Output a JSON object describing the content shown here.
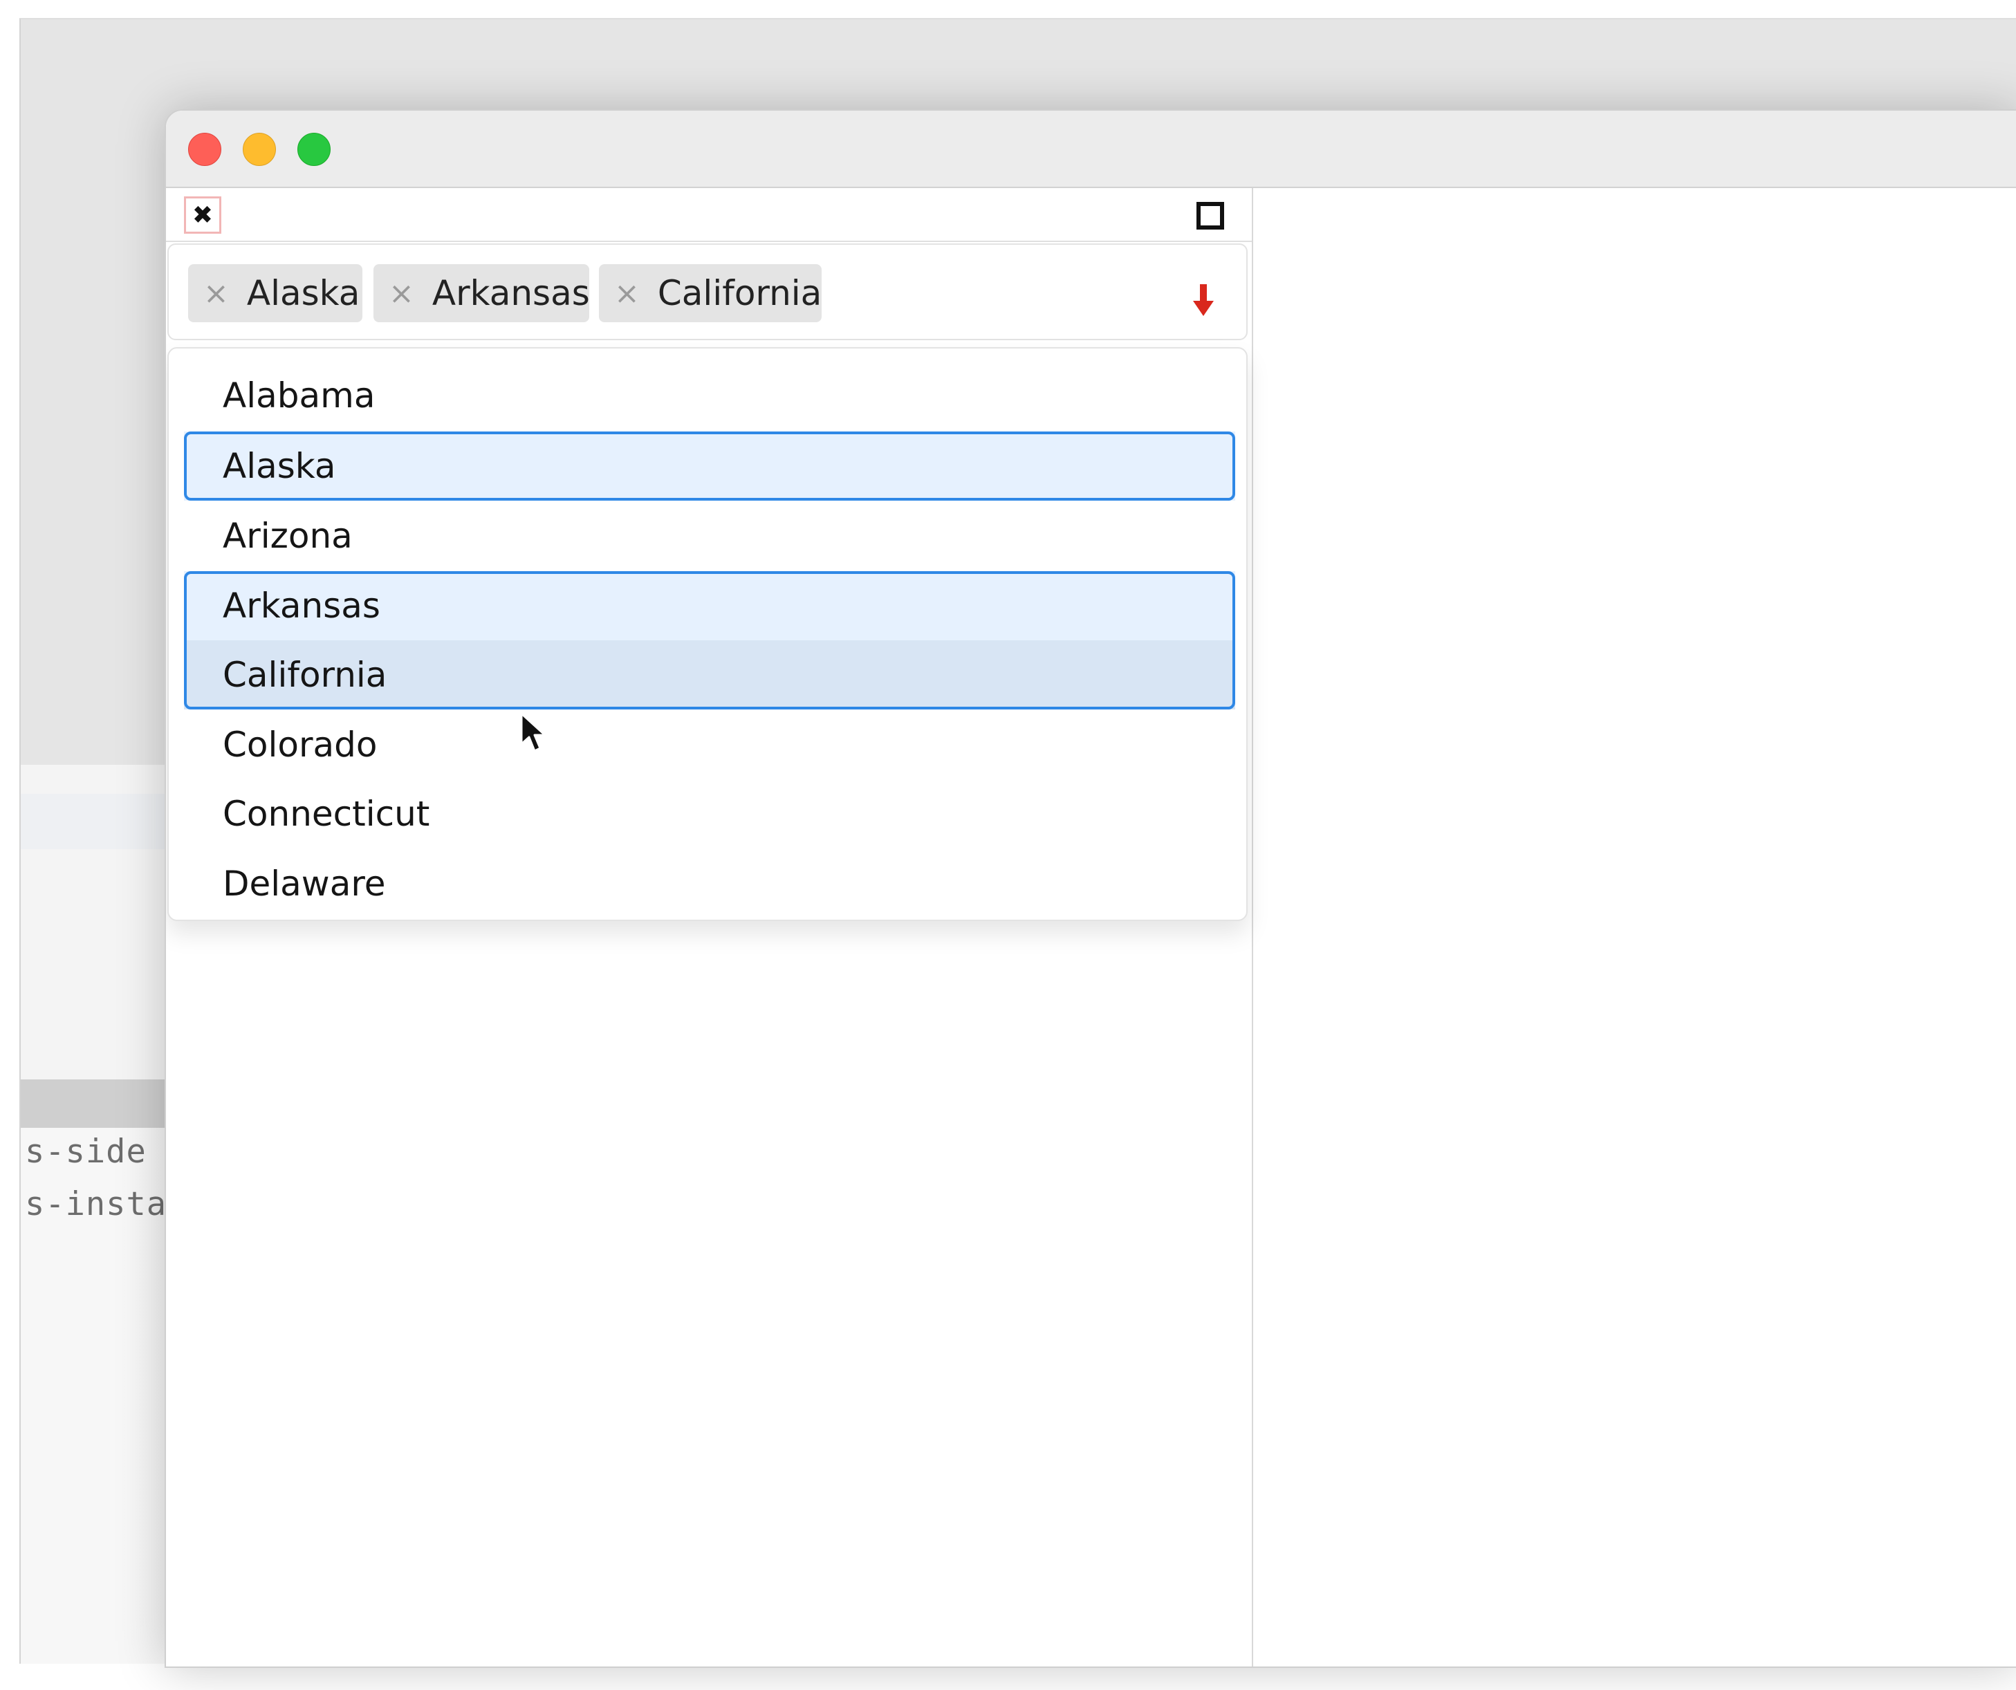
{
  "background": {
    "code_lines": [
      "s-side",
      "s-insta"
    ]
  },
  "window": {
    "traffic_lights": [
      {
        "name": "close",
        "color": "#fe5f57"
      },
      {
        "name": "minimize",
        "color": "#febc2e"
      },
      {
        "name": "maximize",
        "color": "#28c840"
      }
    ]
  },
  "panel": {
    "close_icon": "close-x-icon",
    "maximize_icon": "square-icon",
    "close_glyph": "✖"
  },
  "multiselect": {
    "tags": [
      {
        "label": "Alaska",
        "remove": "×"
      },
      {
        "label": "Arkansas",
        "remove": "×"
      },
      {
        "label": "California",
        "remove": "×"
      }
    ],
    "dropdown_icon": "arrow-down-icon",
    "dropdown_glyph": "🡇",
    "accent_color": "#d9281d"
  },
  "options": [
    {
      "label": "Alabama",
      "selected": false
    },
    {
      "label": "Alaska",
      "selected": true
    },
    {
      "label": "Arizona",
      "selected": false
    },
    {
      "label": "Arkansas",
      "selected": true
    },
    {
      "label": "California",
      "selected": true,
      "hovered": true
    },
    {
      "label": "Colorado",
      "selected": false
    },
    {
      "label": "Connecticut",
      "selected": false
    },
    {
      "label": "Delaware",
      "selected": false
    }
  ],
  "colors": {
    "selected_bg": "#e6f1fe",
    "hover_bg": "#d8e5f4",
    "selection_border": "#2f88e6"
  }
}
